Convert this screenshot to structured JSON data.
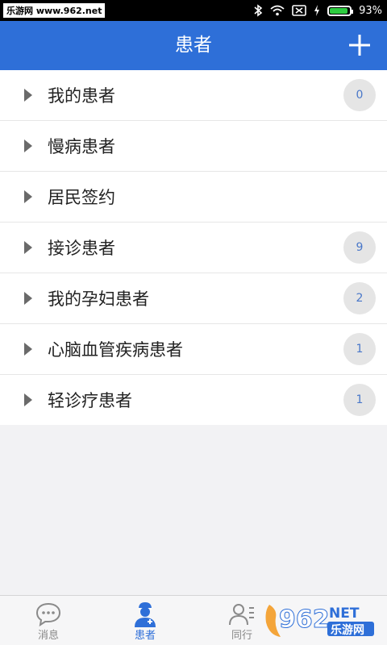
{
  "status_bar": {
    "watermark": "乐游网 www.962.net",
    "battery_percent": "93%",
    "battery_level": 0.93
  },
  "header": {
    "title": "患者",
    "add_icon": "plus-icon"
  },
  "list": {
    "items": [
      {
        "label": "我的患者",
        "badge": "0"
      },
      {
        "label": "慢病患者",
        "badge": ""
      },
      {
        "label": "居民签约",
        "badge": ""
      },
      {
        "label": "接诊患者",
        "badge": "9"
      },
      {
        "label": "我的孕妇患者",
        "badge": "2"
      },
      {
        "label": "心脑血管疾病患者",
        "badge": "1"
      },
      {
        "label": "轻诊疗患者",
        "badge": "1"
      }
    ]
  },
  "tabs": [
    {
      "label": "消息",
      "icon": "chat-bubble-icon",
      "active": false
    },
    {
      "label": "患者",
      "icon": "doctor-icon",
      "active": true
    },
    {
      "label": "同行",
      "icon": "contacts-icon",
      "active": false
    }
  ],
  "overlay_logo": {
    "text_main": "962",
    "text_net": "NET",
    "text_cn": "乐游网"
  },
  "colors": {
    "primary": "#2e6fd8",
    "badge_bg": "#e5e5e5",
    "badge_text": "#4a78c9"
  }
}
